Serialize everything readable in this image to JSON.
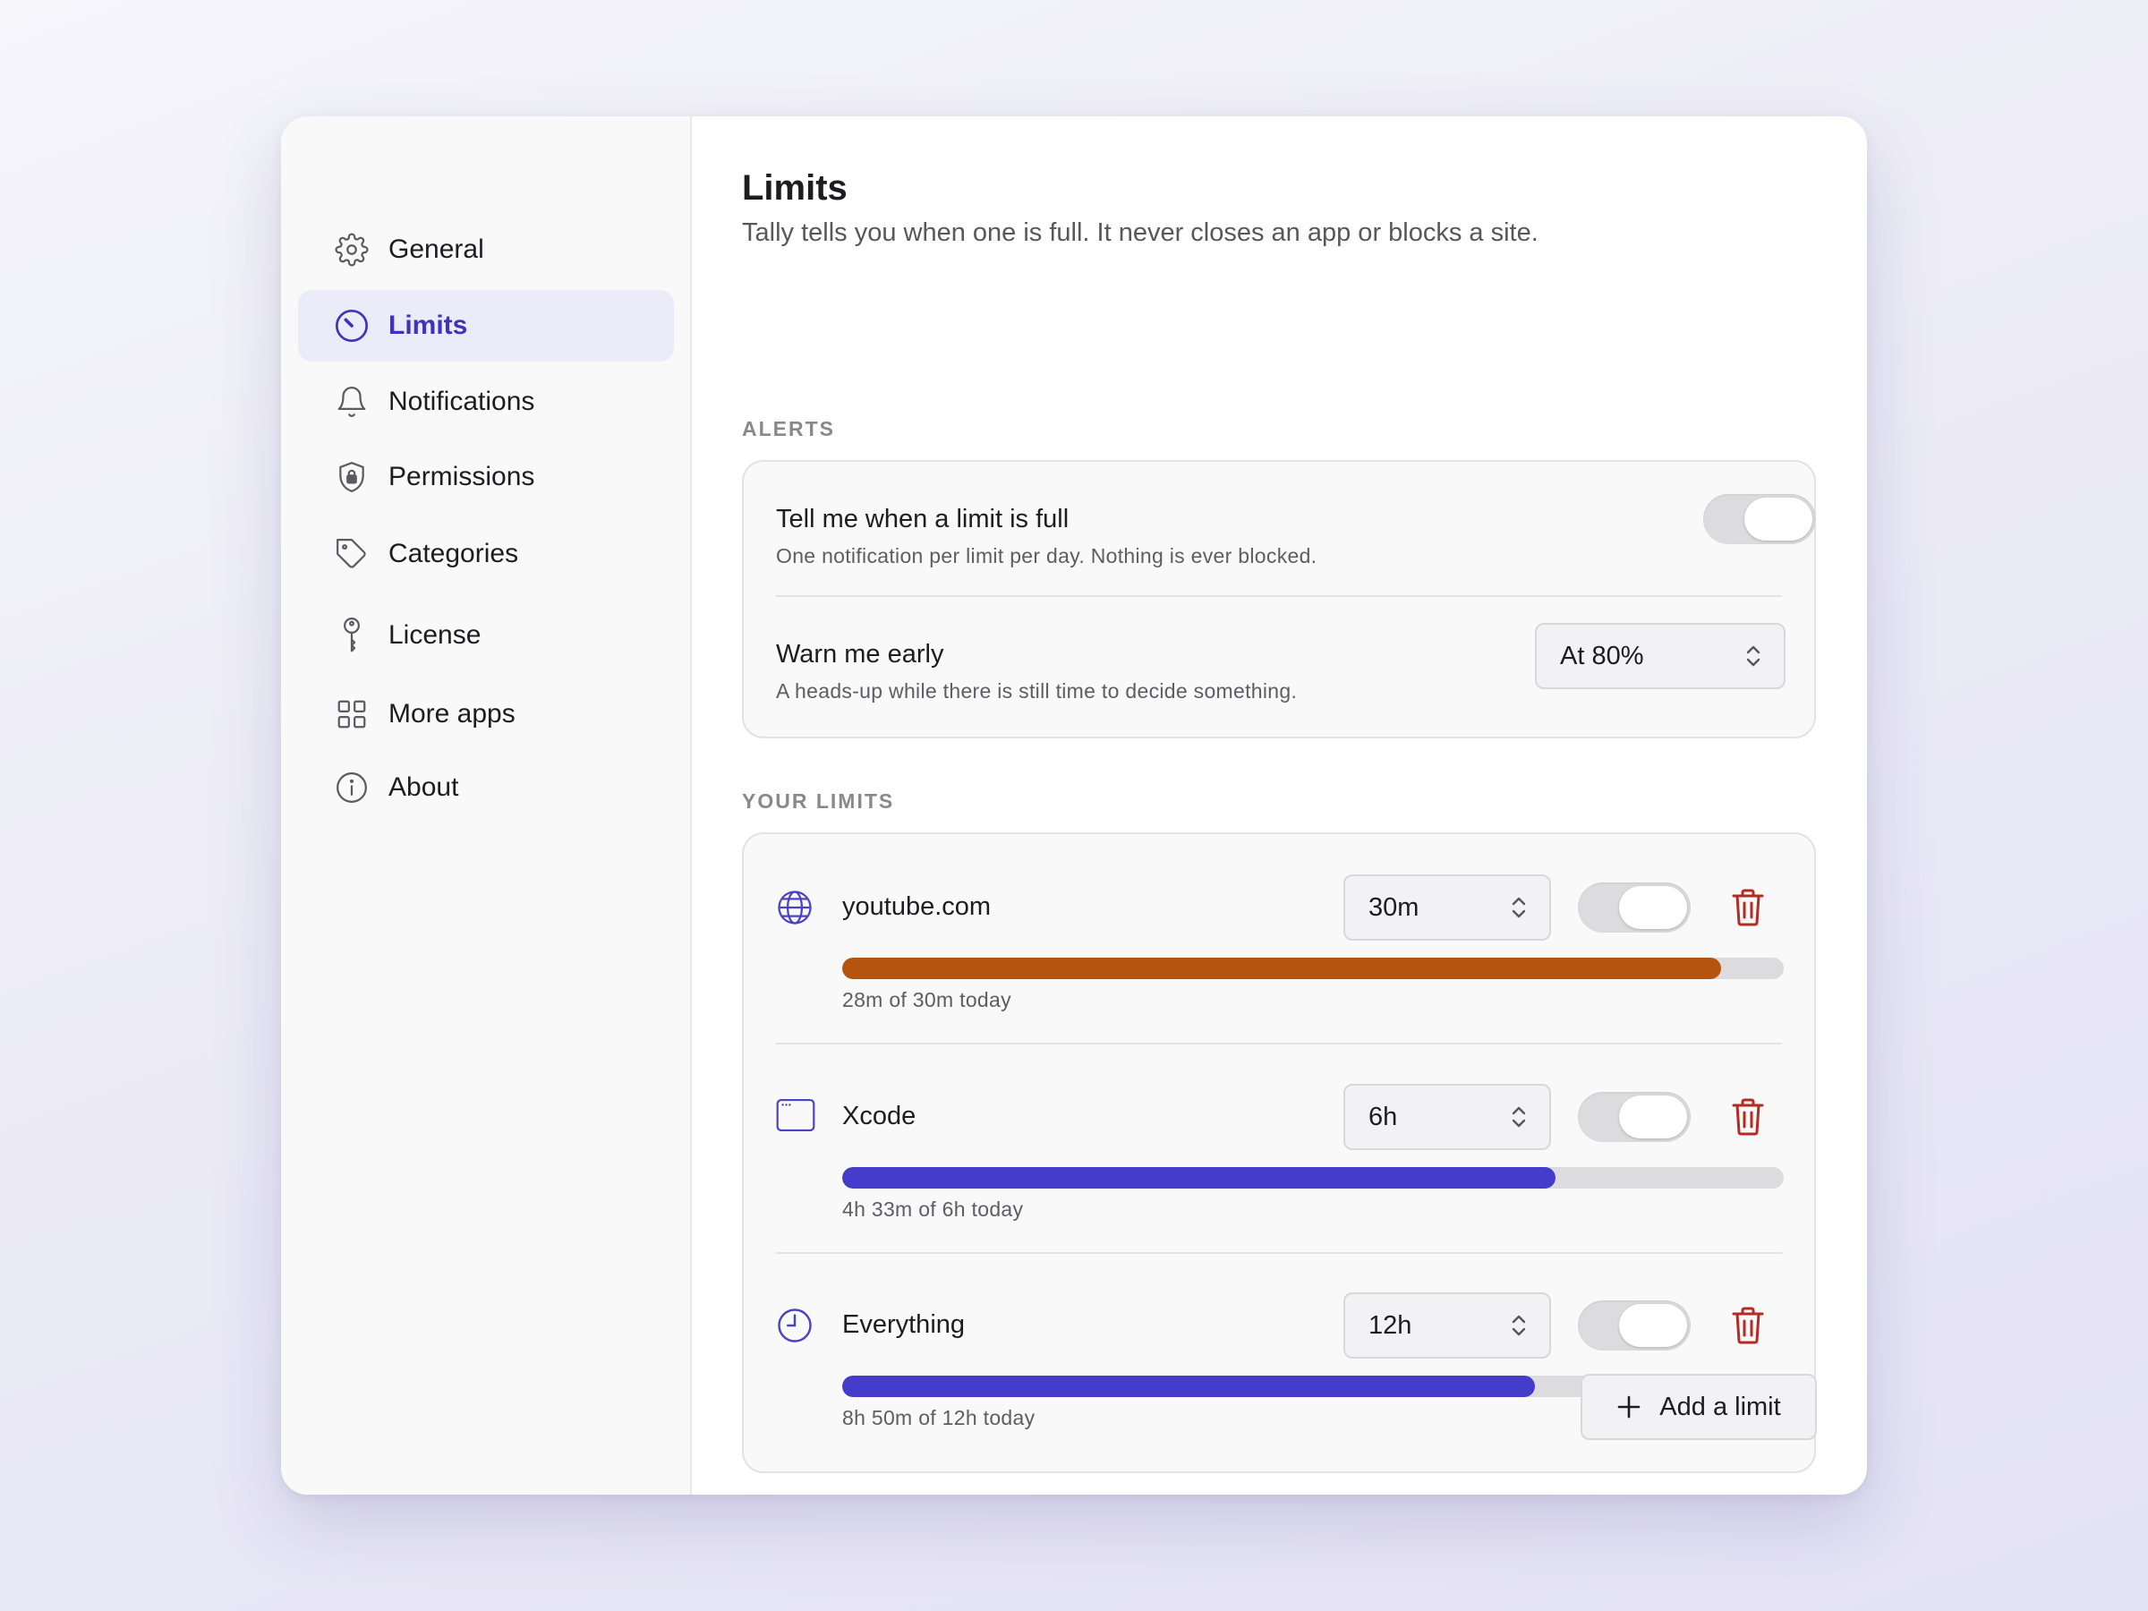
{
  "sidebar": {
    "items": [
      {
        "label": "General",
        "icon": "gear-icon",
        "active": false
      },
      {
        "label": "Limits",
        "icon": "gauge-icon",
        "active": true
      },
      {
        "label": "Notifications",
        "icon": "bell-icon",
        "active": false
      },
      {
        "label": "Permissions",
        "icon": "shield-icon",
        "active": false
      },
      {
        "label": "Categories",
        "icon": "tag-icon",
        "active": false
      },
      {
        "label": "License",
        "icon": "key-icon",
        "active": false
      },
      {
        "label": "More apps",
        "icon": "grid-icon",
        "active": false
      },
      {
        "label": "About",
        "icon": "info-icon",
        "active": false
      }
    ]
  },
  "main": {
    "title": "Limits",
    "subtitle": "Tally tells you when one is full. It never closes an app or blocks a site.",
    "alerts": {
      "section_label": "ALERTS",
      "notify_full": {
        "title": "Tell me when a limit is full",
        "description": "One notification per limit per day. Nothing is ever blocked."
      },
      "warn_early": {
        "title": "Warn me early",
        "description": "A heads-up while there is still time to decide something.",
        "value": "At 80%"
      }
    },
    "your_limits": {
      "section_label": "YOUR LIMITS",
      "items": [
        {
          "name": "youtube.com",
          "icon": "globe-icon",
          "limit": "30m",
          "usage_text": "28m of 30m today",
          "progress": 0.933,
          "color": "#b4540f"
        },
        {
          "name": "Xcode",
          "icon": "app-window-icon",
          "limit": "6h",
          "usage_text": "4h 33m of 6h today",
          "progress": 0.758,
          "color": "#463ccb"
        },
        {
          "name": "Everything",
          "icon": "clock-icon",
          "limit": "12h",
          "usage_text": "8h 50m of 12h today",
          "progress": 0.736,
          "color": "#463ccb"
        }
      ]
    },
    "add_button_label": "Add a limit"
  },
  "colors": {
    "accent": "#3d34b8",
    "progress_warning": "#b4540f",
    "progress_normal": "#463ccb",
    "danger": "#b52a22"
  }
}
